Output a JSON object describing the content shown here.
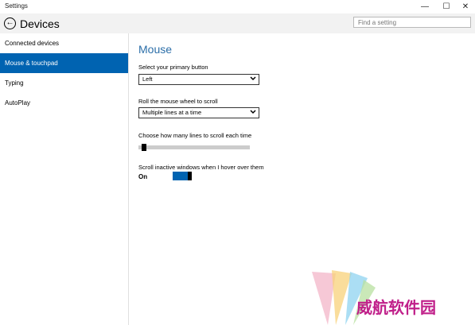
{
  "window": {
    "title": "Settings",
    "min_glyph": "—",
    "max_glyph": "☐",
    "close_glyph": "✕"
  },
  "header": {
    "back_glyph": "←",
    "title": "Devices",
    "search_placeholder": "Find a setting"
  },
  "sidebar": {
    "items": [
      {
        "label": "Connected devices",
        "selected": false
      },
      {
        "label": "Mouse & touchpad",
        "selected": true
      },
      {
        "label": "Typing",
        "selected": false
      },
      {
        "label": "AutoPlay",
        "selected": false
      }
    ]
  },
  "main": {
    "heading": "Mouse",
    "primary_button": {
      "label": "Select your primary button",
      "value": "Left"
    },
    "scroll_wheel": {
      "label": "Roll the mouse wheel to scroll",
      "value": "Multiple lines at a time"
    },
    "lines_to_scroll": {
      "label": "Choose how many lines to scroll each time",
      "level": 0.03
    },
    "inactive_scroll": {
      "label": "Scroll inactive windows when I hover over them",
      "state": "On"
    }
  },
  "watermark": {
    "text": "威航软件园"
  },
  "colors": {
    "accent": "#0063b1",
    "heading": "#2b6ea8",
    "header_bg": "#f2f2f2"
  }
}
